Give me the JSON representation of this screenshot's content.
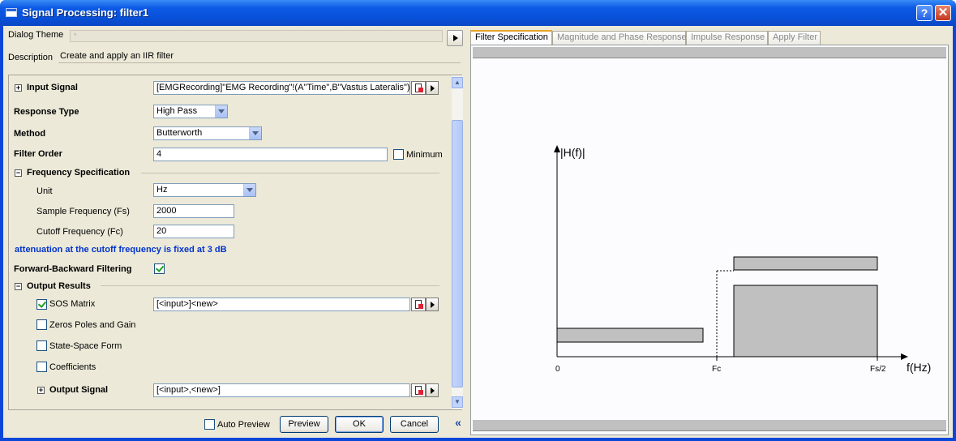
{
  "window": {
    "title": "Signal Processing: filter1"
  },
  "header": {
    "dialog_theme_label": "Dialog Theme",
    "dialog_theme_value": "*",
    "description_label": "Description",
    "description_value": "Create and apply an IIR filter"
  },
  "form": {
    "input_signal": {
      "label": "Input Signal",
      "value": "[EMGRecording]\"EMG Recording\"!(A\"Time\",B\"Vastus Lateralis\")"
    },
    "response_type": {
      "label": "Response Type",
      "value": "High Pass"
    },
    "method": {
      "label": "Method",
      "value": "Butterworth"
    },
    "filter_order": {
      "label": "Filter Order",
      "value": "4",
      "minimum_label": "Minimum",
      "minimum_checked": false
    },
    "frequency_spec": {
      "label": "Frequency Specification",
      "unit_label": "Unit",
      "unit_value": "Hz",
      "fs_label": "Sample Frequency (Fs)",
      "fs_value": "2000",
      "fc_label": "Cutoff Frequency (Fc)",
      "fc_value": "20"
    },
    "note": "attenuation at the cutoff frequency is fixed at 3 dB",
    "forward_backward": {
      "label": "Forward-Backward Filtering",
      "checked": true
    },
    "output_results": {
      "label": "Output Results",
      "sos_label": "SOS Matrix",
      "sos_checked": true,
      "sos_value": "[<input>]<new>",
      "zpg_label": "Zeros Poles and Gain",
      "ss_label": "State-Space Form",
      "coef_label": "Coefficients"
    },
    "output_signal": {
      "label": "Output Signal",
      "value": "[<input>,<new>]"
    }
  },
  "buttons": {
    "auto_preview": "Auto Preview",
    "preview": "Preview",
    "ok": "OK",
    "cancel": "Cancel"
  },
  "tabs": [
    "Filter Specification",
    "Magnitude and Phase Response",
    "Impulse Response",
    "Apply Filter"
  ],
  "plot": {
    "y_label": "|H(f)|",
    "x_label": "f(Hz)",
    "tick_0": "0",
    "tick_fc": "Fc",
    "tick_fs2": "Fs/2"
  }
}
